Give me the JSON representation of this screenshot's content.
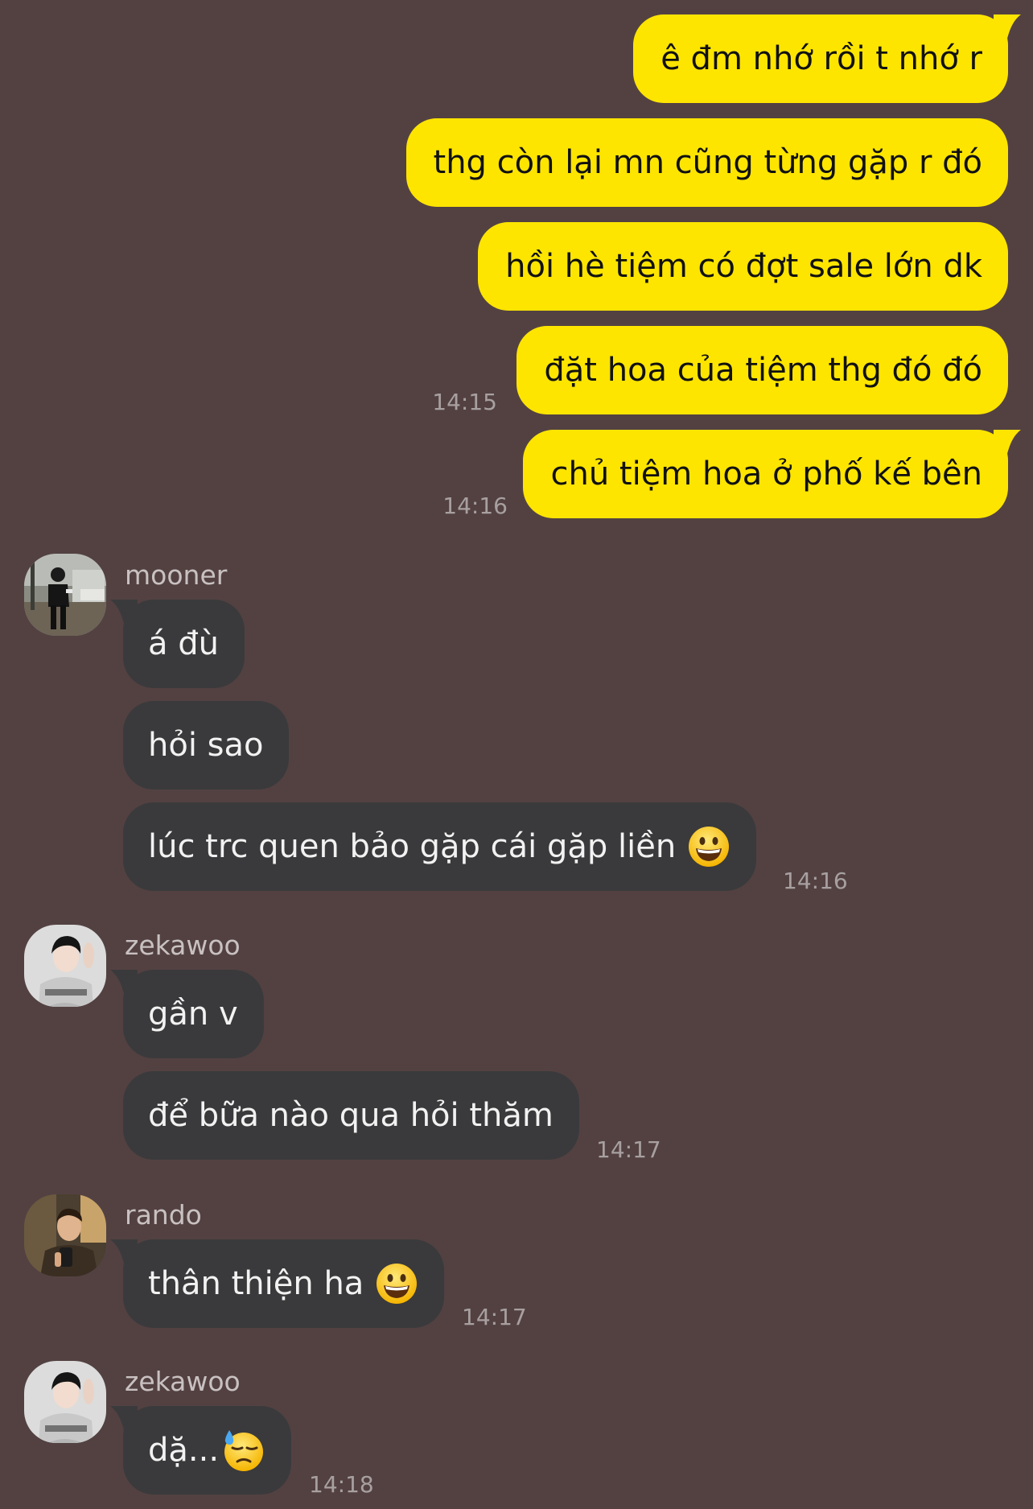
{
  "outgoing": [
    {
      "text": "ê đm nhớ rồi t nhớ r"
    },
    {
      "text": "thg còn lại mn cũng từng gặp r đó"
    },
    {
      "text": "hồi hè tiệm có đợt sale lớn dk"
    },
    {
      "text": "đặt hoa của tiệm thg đó đó",
      "time": "14:15"
    },
    {
      "text": "chủ tiệm hoa ở phố kế bên",
      "time": "14:16"
    }
  ],
  "groups": [
    {
      "sender": "mooner",
      "avatar_icon": "person-walking-street-photo",
      "messages": [
        {
          "text": "á đù"
        },
        {
          "text": "hỏi sao"
        },
        {
          "text": "lúc trc quen bảo gặp cái gặp liền",
          "emoji": "grinning-face-icon",
          "time": "14:16"
        }
      ]
    },
    {
      "sender": "zekawoo",
      "avatar_icon": "boy-in-hoodie-photo",
      "messages": [
        {
          "text": "gần v"
        },
        {
          "text": "để bữa nào qua hỏi thăm",
          "time": "14:17"
        }
      ]
    },
    {
      "sender": "rando",
      "avatar_icon": "selfie-photo",
      "messages": [
        {
          "text": "thân thiện ha",
          "emoji": "grinning-face-icon",
          "time": "14:17"
        }
      ]
    },
    {
      "sender": "zekawoo",
      "avatar_icon": "boy-in-hoodie-photo",
      "messages": [
        {
          "text": "dặ...",
          "emoji": "downcast-face-with-sweat-icon",
          "time": "14:18"
        }
      ]
    }
  ],
  "colors": {
    "background": "#534142",
    "outgoing_bubble": "#fee500",
    "incoming_bubble": "#3a3a3c",
    "timestamp": "#a8a0a0",
    "sender_name": "#c9c1c1"
  }
}
